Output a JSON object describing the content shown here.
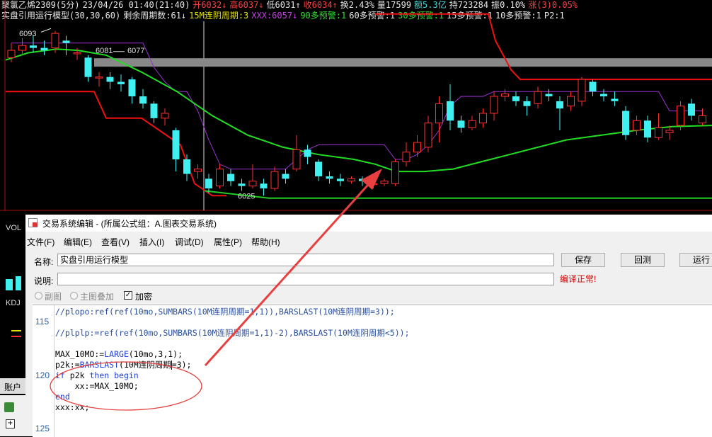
{
  "header": {
    "row1": [
      {
        "text": "聚氯乙烯2309(5分)",
        "color": "#e8e8e8"
      },
      {
        "text": "23/04/26 01:40(21:40)",
        "color": "#e8e8e8"
      },
      {
        "text": "开6032↓",
        "color": "#ff4040"
      },
      {
        "text": "高6037↓",
        "color": "#ff4040"
      },
      {
        "text": "低6031↑",
        "color": "#e8e8e8"
      },
      {
        "text": "收6034↑",
        "color": "#ff4040"
      },
      {
        "text": "换2.43%",
        "color": "#e8e8e8"
      },
      {
        "text": "量17599",
        "color": "#e8e8e8"
      },
      {
        "text": "额5.3亿",
        "color": "#40e0e0"
      },
      {
        "text": "持723284",
        "color": "#e8e8e8"
      },
      {
        "text": "振0.10%",
        "color": "#e8e8e8"
      },
      {
        "text": "涨(3)0.05%",
        "color": "#ff4040"
      }
    ],
    "row2": [
      {
        "text": "实盘引用运行模型(30,30,60)",
        "color": "#e8e8e8"
      },
      {
        "text": "剩余周期数:61↓",
        "color": "#e8e8e8"
      },
      {
        "text": "15M连阴周期:3",
        "color": "#e0e000"
      },
      {
        "text": "XXX:6057↓",
        "color": "#c040e0"
      },
      {
        "text": "90多预警:1",
        "color": "#30e030"
      },
      {
        "text": "60多预警:1",
        "color": "#e8e8e8"
      },
      {
        "text": "30多预警:1",
        "color": "#30e030"
      },
      {
        "text": "15多预警:1",
        "color": "#e8e8e8"
      },
      {
        "text": "10多预警:1",
        "color": "#e8e8e8"
      },
      {
        "text": "P2:1",
        "color": "#e8e8e8"
      }
    ]
  },
  "chart": {
    "price_labels": {
      "high": "6093",
      "mid1": "6081",
      "mid2": "6077",
      "low": "6025"
    },
    "colors": {
      "up": "#ff3030",
      "down": "#40f0f0",
      "ma_green": "#22dd22",
      "upper_red": "#ee1111",
      "purple": "#9932cc",
      "flat_green": "#22cc22"
    },
    "candles": [
      {
        "o": 6082,
        "c": 6085,
        "h": 6088,
        "l": 6080
      },
      {
        "o": 6085,
        "c": 6087,
        "h": 6090,
        "l": 6083
      },
      {
        "o": 6087,
        "c": 6086,
        "h": 6091,
        "l": 6084
      },
      {
        "o": 6086,
        "c": 6085,
        "h": 6089,
        "l": 6083
      },
      {
        "o": 6086,
        "c": 6092,
        "h": 6093,
        "l": 6084
      },
      {
        "o": 6089,
        "c": 6088,
        "h": 6091,
        "l": 6083
      },
      {
        "o": 6084,
        "c": 6084,
        "h": 6086,
        "l": 6081
      },
      {
        "o": 6082,
        "c": 6074,
        "h": 6083,
        "l": 6072
      },
      {
        "o": 6074,
        "c": 6074,
        "h": 6076,
        "l": 6070
      },
      {
        "o": 6074,
        "c": 6072,
        "h": 6076,
        "l": 6069
      },
      {
        "o": 6072,
        "c": 6071,
        "h": 6075,
        "l": 6068
      },
      {
        "o": 6073,
        "c": 6066,
        "h": 6074,
        "l": 6063
      },
      {
        "o": 6066,
        "c": 6063,
        "h": 6069,
        "l": 6061
      },
      {
        "o": 6063,
        "c": 6057,
        "h": 6064,
        "l": 6055
      },
      {
        "o": 6057,
        "c": 6059,
        "h": 6061,
        "l": 6054
      },
      {
        "o": 6052,
        "c": 6040,
        "h": 6053,
        "l": 6035
      },
      {
        "o": 6040,
        "c": 6034,
        "h": 6042,
        "l": 6031
      },
      {
        "o": 6035,
        "c": 6036,
        "h": 6038,
        "l": 6032
      },
      {
        "o": 6032,
        "c": 6028,
        "h": 6034,
        "l": 6026
      },
      {
        "o": 6029,
        "c": 6036,
        "h": 6038,
        "l": 6028
      },
      {
        "o": 6034,
        "c": 6031,
        "h": 6036,
        "l": 6029
      },
      {
        "o": 6030,
        "c": 6029,
        "h": 6032,
        "l": 6027
      },
      {
        "o": 6029,
        "c": 6031,
        "h": 6038,
        "l": 6028
      },
      {
        "o": 6030,
        "c": 6028,
        "h": 6032,
        "l": 6025
      },
      {
        "o": 6028,
        "c": 6035,
        "h": 6037,
        "l": 6027
      },
      {
        "o": 6034,
        "c": 6032,
        "h": 6036,
        "l": 6030
      },
      {
        "o": 6036,
        "c": 6044,
        "h": 6050,
        "l": 6035
      },
      {
        "o": 6044,
        "c": 6041,
        "h": 6046,
        "l": 6038
      },
      {
        "o": 6039,
        "c": 6033,
        "h": 6040,
        "l": 6031
      },
      {
        "o": 6033,
        "c": 6032,
        "h": 6035,
        "l": 6030
      },
      {
        "o": 6032,
        "c": 6031,
        "h": 6034,
        "l": 6029
      },
      {
        "o": 6031,
        "c": 6032,
        "h": 6033,
        "l": 6030
      },
      {
        "o": 6032,
        "c": 6031,
        "h": 6033,
        "l": 6029
      },
      {
        "o": 6030,
        "c": 6030,
        "h": 6032,
        "l": 6028
      },
      {
        "o": 6030,
        "c": 6031,
        "h": 6032,
        "l": 6029
      },
      {
        "o": 6030,
        "c": 6039,
        "h": 6040,
        "l": 6029
      },
      {
        "o": 6039,
        "c": 6043,
        "h": 6047,
        "l": 6037
      },
      {
        "o": 6043,
        "c": 6047,
        "h": 6050,
        "l": 6041
      },
      {
        "o": 6045,
        "c": 6055,
        "h": 6058,
        "l": 6043
      },
      {
        "o": 6055,
        "c": 6063,
        "h": 6066,
        "l": 6047
      },
      {
        "o": 6064,
        "c": 6056,
        "h": 6071,
        "l": 6052
      },
      {
        "o": 6056,
        "c": 6053,
        "h": 6058,
        "l": 6051
      },
      {
        "o": 6053,
        "c": 6056,
        "h": 6058,
        "l": 6052
      },
      {
        "o": 6055,
        "c": 6059,
        "h": 6061,
        "l": 6053
      },
      {
        "o": 6059,
        "c": 6066,
        "h": 6068,
        "l": 6056
      },
      {
        "o": 6066,
        "c": 6067,
        "h": 6069,
        "l": 6064
      },
      {
        "o": 6066,
        "c": 6064,
        "h": 6068,
        "l": 6062
      },
      {
        "o": 6064,
        "c": 6062,
        "h": 6066,
        "l": 6058
      },
      {
        "o": 6063,
        "c": 6068,
        "h": 6070,
        "l": 6061
      },
      {
        "o": 6067,
        "c": 6066,
        "h": 6069,
        "l": 6064
      },
      {
        "o": 6064,
        "c": 6061,
        "h": 6066,
        "l": 6052
      },
      {
        "o": 6062,
        "c": 6066,
        "h": 6068,
        "l": 6060
      },
      {
        "o": 6064,
        "c": 6073,
        "h": 6074,
        "l": 6062
      },
      {
        "o": 6072,
        "c": 6068,
        "h": 6073,
        "l": 6066
      },
      {
        "o": 6067,
        "c": 6066,
        "h": 6069,
        "l": 6064
      },
      {
        "o": 6065,
        "c": 6064,
        "h": 6068,
        "l": 6062
      },
      {
        "o": 6060,
        "c": 6050,
        "h": 6062,
        "l": 6048
      },
      {
        "o": 6052,
        "c": 6056,
        "h": 6058,
        "l": 6050
      },
      {
        "o": 6056,
        "c": 6049,
        "h": 6058,
        "l": 6047
      },
      {
        "o": 6049,
        "c": 6053,
        "h": 6059,
        "l": 6048
      },
      {
        "o": 6051,
        "c": 6052,
        "h": 6054,
        "l": 6048
      },
      {
        "o": 6054,
        "c": 6062,
        "h": 6064,
        "l": 6052
      },
      {
        "o": 6063,
        "c": 6058,
        "h": 6065,
        "l": 6056
      },
      {
        "o": 6055,
        "c": 6058,
        "h": 6061,
        "l": 6054
      }
    ]
  },
  "left_strip": {
    "vol": "VOL",
    "kdj": "KDJ",
    "account": "账户"
  },
  "editor": {
    "title": "交易系统编辑 - (所属公式组：A.图表交易系统)",
    "menu": [
      "文件(F)",
      "编辑(E)",
      "查看(V)",
      "插入(I)",
      "调试(D)",
      "属性(P)",
      "帮助(H)"
    ],
    "name_label": "名称:",
    "name_value": "实盘引用运行模型",
    "desc_label": "说明:",
    "desc_value": "",
    "buttons": {
      "save": "保存",
      "backtest": "回测",
      "run": "运行"
    },
    "status": "编译正常!",
    "options": {
      "subchart": "副图",
      "overlay": "主图叠加",
      "encrypt": "加密"
    },
    "line_numbers": [
      "115",
      "120",
      "125"
    ],
    "code": {
      "l1": "//plopo:ref(ref(10mo,SUMBARS(10M连阴周期=1,1)),BARSLAST(10M连阴周期=3));",
      "l2": "//plplp:=ref(ref(10mo,SUMBARS(10M连阴周期=1,1)-2),BARSLAST(10M连阴周期<5));",
      "l3a": "MAX_10MO:=",
      "l3fn": "LARGE",
      "l3b": "(10mo,3,1);",
      "l4a": "p2k:=",
      "l4fn": "BARSLAST",
      "l4b": "(10M连阴周期",
      "l4c": "=3);",
      "l5kw1": "if",
      "l5mid": " p2k ",
      "l5kw2": "then begin",
      "l6": "    xx:=MAX_10MO;",
      "l7": "end",
      "l8": "xxx:xx;"
    }
  }
}
